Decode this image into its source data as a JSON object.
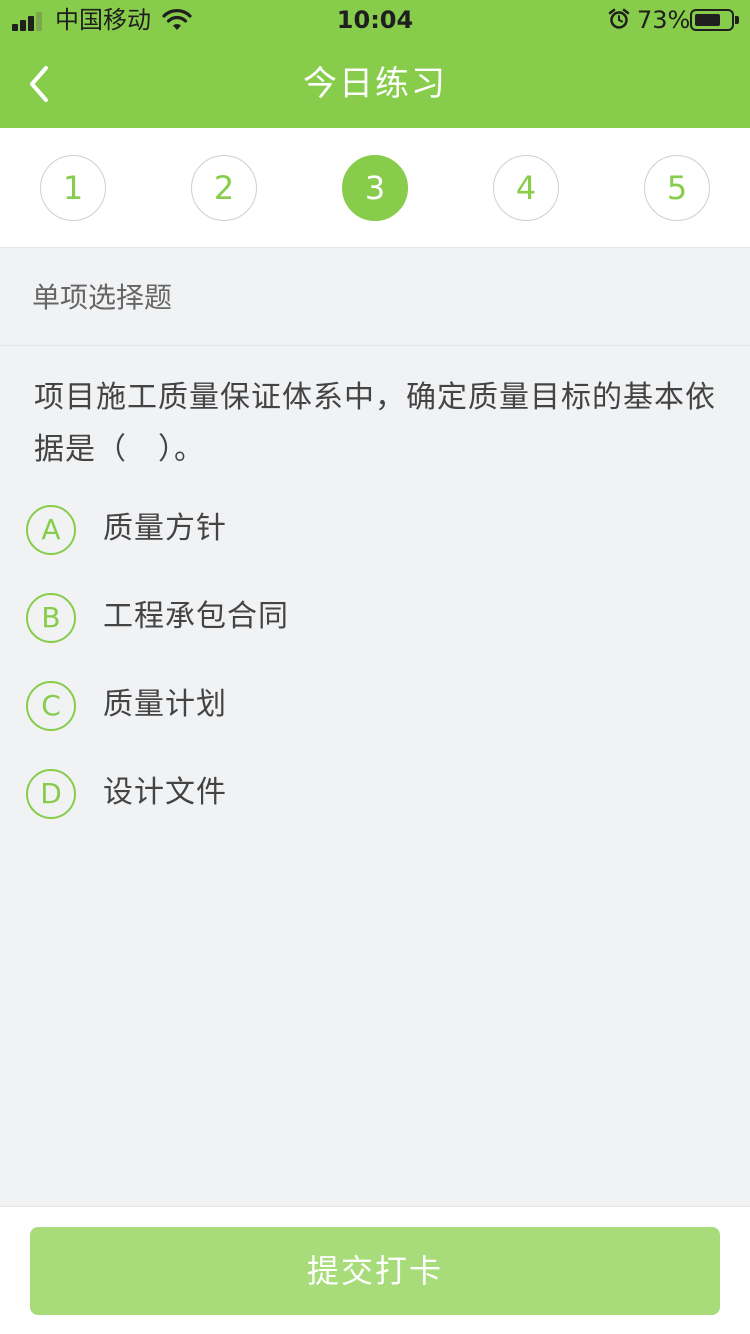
{
  "status_bar": {
    "carrier": "中国移动",
    "time": "10:04",
    "battery_percent_text": "73%",
    "battery_level": 0.73,
    "icons": [
      "signal-icon",
      "wifi-icon",
      "alarm-icon",
      "battery-icon"
    ]
  },
  "nav": {
    "title": "今日练习",
    "back_icon": "chevron-left-icon"
  },
  "question_numbers": {
    "items": [
      "1",
      "2",
      "3",
      "4",
      "5"
    ],
    "active": "3"
  },
  "section": {
    "label": "单项选择题"
  },
  "question": {
    "text": "项目施工质量保证体系中，确定质量目标的基本依据是（　）。"
  },
  "options": [
    {
      "letter": "A",
      "text": "质量方针"
    },
    {
      "letter": "B",
      "text": "工程承包合同"
    },
    {
      "letter": "C",
      "text": "质量计划"
    },
    {
      "letter": "D",
      "text": "设计文件"
    }
  ],
  "submit": {
    "label": "提交打卡"
  },
  "colors": {
    "primary": "#87cc4b",
    "button_disabled": "#a8dc7a",
    "background": "#f1f2f4",
    "text": "#444444"
  }
}
